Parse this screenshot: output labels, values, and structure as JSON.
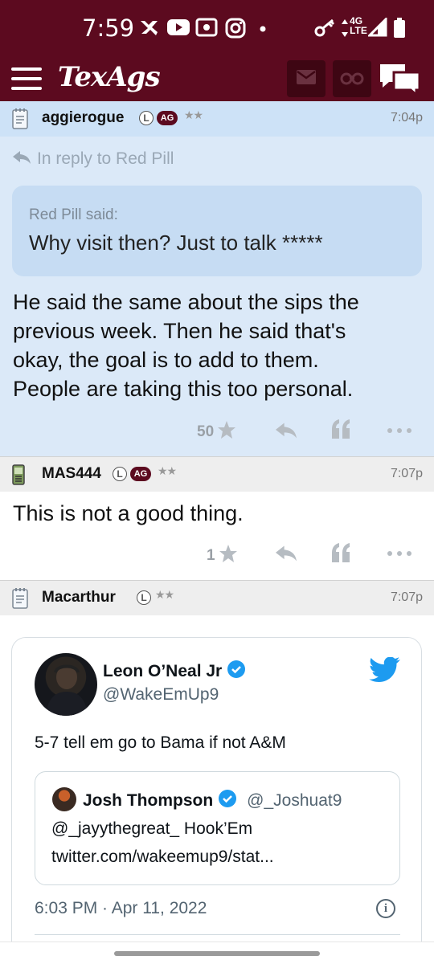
{
  "status_bar": {
    "time": "7:59",
    "network": "4G LTE",
    "icons": [
      "bird-icon",
      "youtube-icon",
      "radio-icon",
      "instagram-icon",
      "dot-icon",
      "key-icon",
      "data-arrows-icon",
      "signal-icon",
      "battery-icon"
    ]
  },
  "header": {
    "brand": "TexAgs",
    "icons": [
      "menu-icon",
      "mail-icon",
      "binoculars-icon",
      "chat-icon"
    ],
    "accent": "#5c0a1f"
  },
  "posts": [
    {
      "user": "aggierogue",
      "badges": [
        "L",
        "AG"
      ],
      "stars": "★★",
      "time": "7:04p",
      "reply_to": "In reply to Red Pill",
      "quote_author": "Red Pill said:",
      "quote_text": "Why visit then? Just to talk *****",
      "lines": [
        "He said the same about the sips the",
        "previous week. Then he said that's",
        "okay, the goal is to add to them.",
        "People are taking this too personal."
      ],
      "likes": "50"
    },
    {
      "user": "MAS444",
      "badges": [
        "L",
        "AG"
      ],
      "stars": "★★",
      "time": "7:07p",
      "lines": [
        "This is not a good thing."
      ],
      "likes": "1"
    },
    {
      "user": "Macarthur",
      "badges": [
        "L"
      ],
      "stars": "★★",
      "time": "7:07p"
    }
  ],
  "tweet": {
    "name": "Leon O’Neal Jr",
    "handle": "@WakeEmUp9",
    "text": "5-7 tell em go to Bama if not A&M",
    "quoted": {
      "name": "Josh Thompson",
      "handle": "@_Joshuat9",
      "line1": "@_jayythegreat_ Hook’Em",
      "line2": "twitter.com/wakeemup9/stat..."
    },
    "date": "6:03 PM · Apr 11, 2022",
    "info_glyph": "i"
  }
}
